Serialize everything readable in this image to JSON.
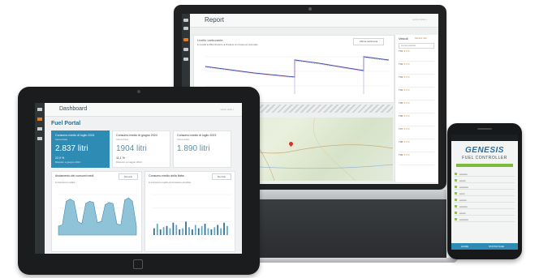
{
  "laptop": {
    "report_title": "Report",
    "chart_title": "Livello carburante",
    "legend": "● Livello  ● Rifornimento  ● Prelievo  ● Consumo anomalo",
    "select_label": "Ultima settimana",
    "side_title": "Veicoli",
    "side_link": "Mostra tutti",
    "search_placeholder": "Cerca veicolo",
    "side_items": [
      "T01",
      "T02",
      "T03",
      "T04",
      "T05",
      "T06",
      "T07",
      "T08",
      "T09"
    ]
  },
  "tablet": {
    "dashboard_title": "Dashboard",
    "section_title": "Fuel Portal",
    "cards": [
      {
        "title": "Consumo medio di luglio 2024",
        "sub": "Intera flotta",
        "value": "2.837 litri",
        "pct": "22,9 %",
        "pct_label": "Rispetto a giugno 2024"
      },
      {
        "title": "Consumo medio di giugno 2024",
        "sub": "Intera flotta",
        "value": "1904 litri",
        "pct": "11,1 %",
        "pct_label": "Rispetto a maggio 2024"
      },
      {
        "title": "Consumo medio di luglio 2023",
        "sub": "Intera flotta",
        "value": "1.890 litri",
        "pct": "",
        "pct_label": ""
      }
    ],
    "panel_left": {
      "title": "Andamento dei consumi medi",
      "dropdown": "Mensile",
      "legend": "● Consumo medio"
    },
    "panel_right": {
      "title": "Consumo medio della flotta",
      "dropdown": "Mensile",
      "legend": "● Consumo medio  ● Consumo previsto"
    },
    "area_values": [
      8,
      9,
      30,
      32,
      30,
      12,
      10,
      28,
      30,
      29,
      11,
      12,
      27,
      29,
      28,
      10,
      9,
      31,
      33,
      30,
      8
    ],
    "bar_values": [
      6,
      10,
      5,
      7,
      8,
      6,
      11,
      9,
      5,
      6,
      12,
      7,
      5,
      9,
      6,
      8,
      10,
      6,
      5,
      7,
      9,
      6,
      11,
      8
    ]
  },
  "phone": {
    "logo": "GENESIS",
    "subtitle": "FUEL CONTROLLER",
    "footer_left": "HOME",
    "footer_right": "STATISTICHE"
  }
}
